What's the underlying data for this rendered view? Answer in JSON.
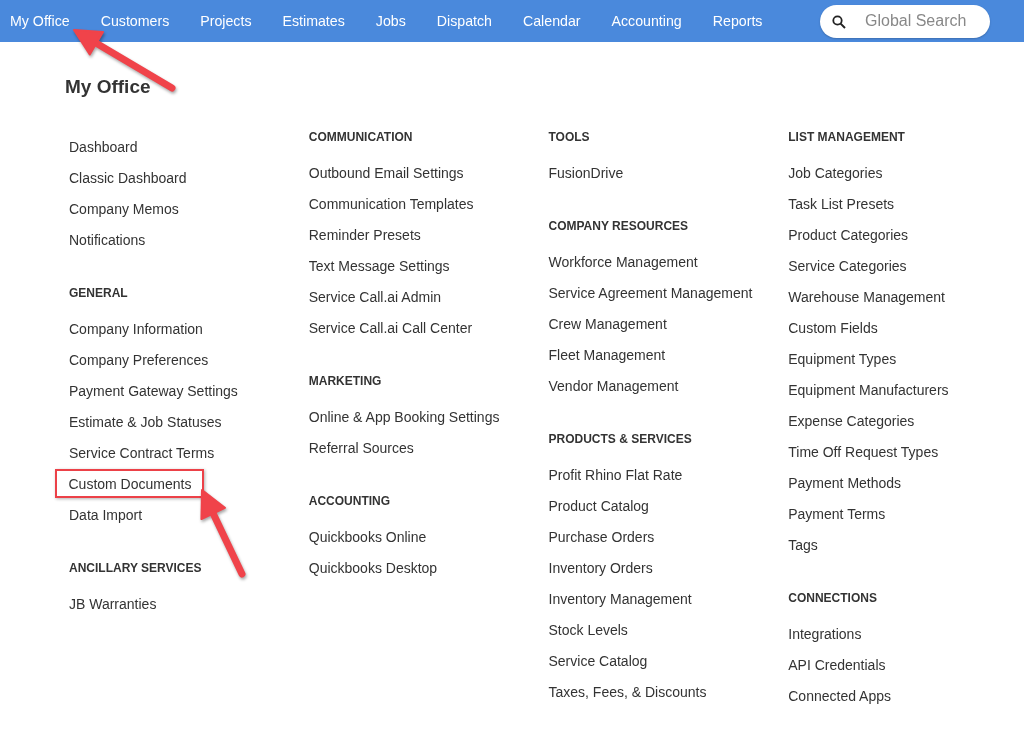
{
  "nav": {
    "items": [
      {
        "label": "My Office",
        "annotated": true
      },
      {
        "label": "Customers",
        "annotated": false
      },
      {
        "label": "Projects",
        "annotated": false
      },
      {
        "label": "Estimates",
        "annotated": false
      },
      {
        "label": "Jobs",
        "annotated": false
      },
      {
        "label": "Dispatch",
        "annotated": false
      },
      {
        "label": "Calendar",
        "annotated": false
      },
      {
        "label": "Accounting",
        "annotated": false
      },
      {
        "label": "Reports",
        "annotated": false
      }
    ],
    "search": {
      "placeholder": "Global Search"
    }
  },
  "page_title": "My Office",
  "columns": [
    {
      "sections": [
        {
          "links": [
            {
              "label": "Dashboard",
              "highlighted": false
            },
            {
              "label": "Classic Dashboard",
              "highlighted": false
            },
            {
              "label": "Company Memos",
              "highlighted": false
            },
            {
              "label": "Notifications",
              "highlighted": false
            }
          ]
        },
        {
          "heading": "GENERAL",
          "links": [
            {
              "label": "Company Information",
              "highlighted": false
            },
            {
              "label": "Company Preferences",
              "highlighted": false
            },
            {
              "label": "Payment Gateway Settings",
              "highlighted": false
            },
            {
              "label": "Estimate & Job Statuses",
              "highlighted": false
            },
            {
              "label": "Service Contract Terms",
              "highlighted": false
            },
            {
              "label": "Custom Documents",
              "highlighted": true
            },
            {
              "label": "Data Import",
              "highlighted": false
            }
          ]
        },
        {
          "heading": "ANCILLARY SERVICES",
          "links": [
            {
              "label": "JB Warranties",
              "highlighted": false
            }
          ]
        }
      ]
    },
    {
      "sections": [
        {
          "heading": "COMMUNICATION",
          "links": [
            {
              "label": "Outbound Email Settings",
              "highlighted": false
            },
            {
              "label": "Communication Templates",
              "highlighted": false
            },
            {
              "label": "Reminder Presets",
              "highlighted": false
            },
            {
              "label": "Text Message Settings",
              "highlighted": false
            },
            {
              "label": "Service Call.ai Admin",
              "highlighted": false
            },
            {
              "label": "Service Call.ai Call Center",
              "highlighted": false
            }
          ]
        },
        {
          "heading": "MARKETING",
          "links": [
            {
              "label": "Online & App Booking Settings",
              "highlighted": false
            },
            {
              "label": "Referral Sources",
              "highlighted": false
            }
          ]
        },
        {
          "heading": "ACCOUNTING",
          "links": [
            {
              "label": "Quickbooks Online",
              "highlighted": false
            },
            {
              "label": "Quickbooks Desktop",
              "highlighted": false
            }
          ]
        }
      ]
    },
    {
      "sections": [
        {
          "heading": "TOOLS",
          "links": [
            {
              "label": "FusionDrive",
              "highlighted": false
            }
          ]
        },
        {
          "heading": "COMPANY RESOURCES",
          "links": [
            {
              "label": "Workforce Management",
              "highlighted": false
            },
            {
              "label": "Service Agreement Management",
              "highlighted": false
            },
            {
              "label": "Crew Management",
              "highlighted": false
            },
            {
              "label": "Fleet Management",
              "highlighted": false
            },
            {
              "label": "Vendor Management",
              "highlighted": false
            }
          ]
        },
        {
          "heading": "PRODUCTS & SERVICES",
          "links": [
            {
              "label": "Profit Rhino Flat Rate",
              "highlighted": false
            },
            {
              "label": "Product Catalog",
              "highlighted": false
            },
            {
              "label": "Purchase Orders",
              "highlighted": false
            },
            {
              "label": "Inventory Orders",
              "highlighted": false
            },
            {
              "label": "Inventory Management",
              "highlighted": false
            },
            {
              "label": "Stock Levels",
              "highlighted": false
            },
            {
              "label": "Service Catalog",
              "highlighted": false
            },
            {
              "label": "Taxes, Fees, & Discounts",
              "highlighted": false
            }
          ]
        }
      ]
    },
    {
      "sections": [
        {
          "heading": "LIST MANAGEMENT",
          "links": [
            {
              "label": "Job Categories",
              "highlighted": false
            },
            {
              "label": "Task List Presets",
              "highlighted": false
            },
            {
              "label": "Product Categories",
              "highlighted": false
            },
            {
              "label": "Service Categories",
              "highlighted": false
            },
            {
              "label": "Warehouse Management",
              "highlighted": false
            },
            {
              "label": "Custom Fields",
              "highlighted": false
            },
            {
              "label": "Equipment Types",
              "highlighted": false
            },
            {
              "label": "Equipment Manufacturers",
              "highlighted": false
            },
            {
              "label": "Expense Categories",
              "highlighted": false
            },
            {
              "label": "Time Off Request Types",
              "highlighted": false
            },
            {
              "label": "Payment Methods",
              "highlighted": false
            },
            {
              "label": "Payment Terms",
              "highlighted": false
            },
            {
              "label": "Tags",
              "highlighted": false
            }
          ]
        },
        {
          "heading": "CONNECTIONS",
          "links": [
            {
              "label": "Integrations",
              "highlighted": false
            },
            {
              "label": "API Credentials",
              "highlighted": false
            },
            {
              "label": "Connected Apps",
              "highlighted": false
            }
          ]
        }
      ]
    }
  ]
}
